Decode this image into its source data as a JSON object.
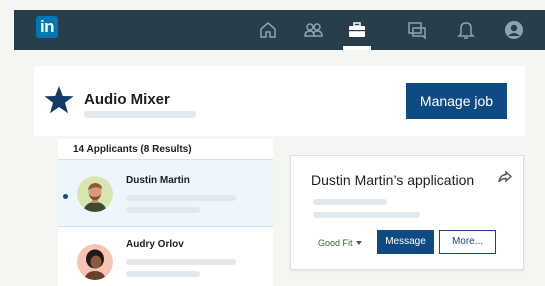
{
  "navbar": {
    "logo_text": "in",
    "icons": [
      "home-icon",
      "network-icon",
      "jobs-icon",
      "messaging-icon",
      "notifications-icon",
      "profile-icon"
    ],
    "active": "jobs-icon"
  },
  "job": {
    "title": "Audio Mixer",
    "manage_label": "Manage job",
    "star_color": "#123a6b"
  },
  "applicants": {
    "header": "14 Applicants (8 Results)",
    "list": [
      {
        "name": "Dustin Martin",
        "selected": true,
        "avatar": "dustin-avatar"
      },
      {
        "name": "Audry Orlov",
        "selected": false,
        "avatar": "audry-avatar"
      }
    ]
  },
  "application": {
    "title": "Dustin Martin’s application",
    "fit_label": "Good Fit",
    "message_label": "Message",
    "more_label": "More..."
  },
  "colors": {
    "nav_bg": "#283e4a",
    "brand_blue": "#0077b5",
    "primary_button": "#0e4b84",
    "page_bg": "#f3f6f1",
    "selected_row_bg": "#eef5fb"
  }
}
